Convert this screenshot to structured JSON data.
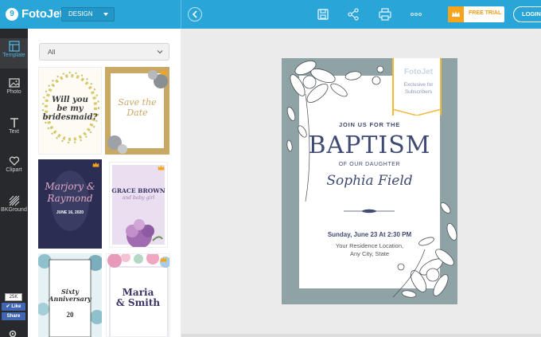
{
  "app": {
    "logo_text": "FotoJet",
    "design_dropdown": "DESIGN",
    "free_trial": "FREE TRIAL",
    "login": "LOGIN"
  },
  "toolbar_icons": [
    "back-icon",
    "save-icon",
    "share-icon",
    "print-icon",
    "more-icon"
  ],
  "sidebar": {
    "items": [
      {
        "label": "Template",
        "icon": "template-icon"
      },
      {
        "label": "Photo",
        "icon": "photo-icon"
      },
      {
        "label": "Text",
        "icon": "text-icon"
      },
      {
        "label": "Clipart",
        "icon": "heart-icon"
      },
      {
        "label": "BKGround",
        "icon": "background-icon"
      }
    ],
    "like_count": "25K",
    "like_label": "Like",
    "share_label": "Share"
  },
  "templates": {
    "filter_value": "All",
    "items": [
      {
        "lines": [
          "Will you",
          "be my",
          "bridesmaid?"
        ],
        "premium": false
      },
      {
        "lines": [
          "Save the",
          "Date"
        ],
        "premium": true
      },
      {
        "lines": [
          "Marjory &",
          "Raymond",
          "JUNE 16, 2020"
        ],
        "premium": true
      },
      {
        "lines": [
          "GRACE BROWN",
          "and baby girl"
        ],
        "premium": true
      },
      {
        "lines": [
          "Sixty",
          "Anniversary",
          "20"
        ],
        "premium": true
      },
      {
        "lines": [
          "Maria",
          "& Smith"
        ],
        "premium": true
      }
    ]
  },
  "card": {
    "join": "JOIN US FOR THE",
    "title": "BAPTISM",
    "of": "OF OUR DAUGHTER",
    "name": "Sophia Field",
    "date": "Sunday, June 23 At 2:30 PM",
    "location1": "Your Residence Location,",
    "location2": "Any City, State",
    "badge_logo": "FotoJet",
    "badge_line1": "Exclusive for",
    "badge_line2": "Subscribers"
  },
  "colors": {
    "topbar": "#2aa5d8",
    "rail": "#28292c",
    "accent": "#4cb5e2",
    "premium": "#f6a41c",
    "card_frame": "#8fa3a6",
    "card_text": "#3f4a73"
  }
}
